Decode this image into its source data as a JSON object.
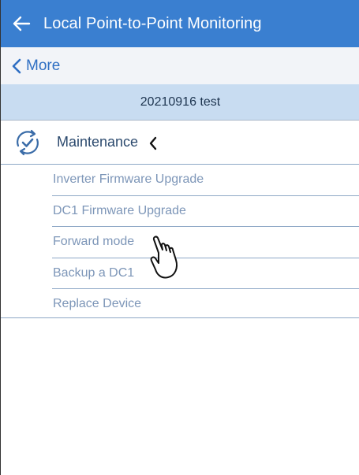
{
  "header": {
    "title": "Local Point-to-Point Monitoring",
    "back_icon": "arrow-left-icon"
  },
  "nav": {
    "more_label": "More",
    "more_icon": "chevron-left-icon"
  },
  "device": {
    "name": "20210916 test"
  },
  "section": {
    "title": "Maintenance",
    "icon": "sync-check-icon",
    "expand_icon": "chevron-left-icon"
  },
  "menu": {
    "items": [
      {
        "label": "Inverter Firmware Upgrade"
      },
      {
        "label": "DC1 Firmware Upgrade"
      },
      {
        "label": "Forward mode"
      },
      {
        "label": "Backup a DC1"
      },
      {
        "label": "Replace Device"
      }
    ]
  },
  "overlay": {
    "pointer_icon": "hand-pointer-icon"
  },
  "colors": {
    "header_bg": "#3a7fd0",
    "device_bar_bg": "#c8dcf1",
    "link": "#2f6fc3",
    "menu_text": "#7d96b8",
    "divider": "#8ea8c6"
  }
}
